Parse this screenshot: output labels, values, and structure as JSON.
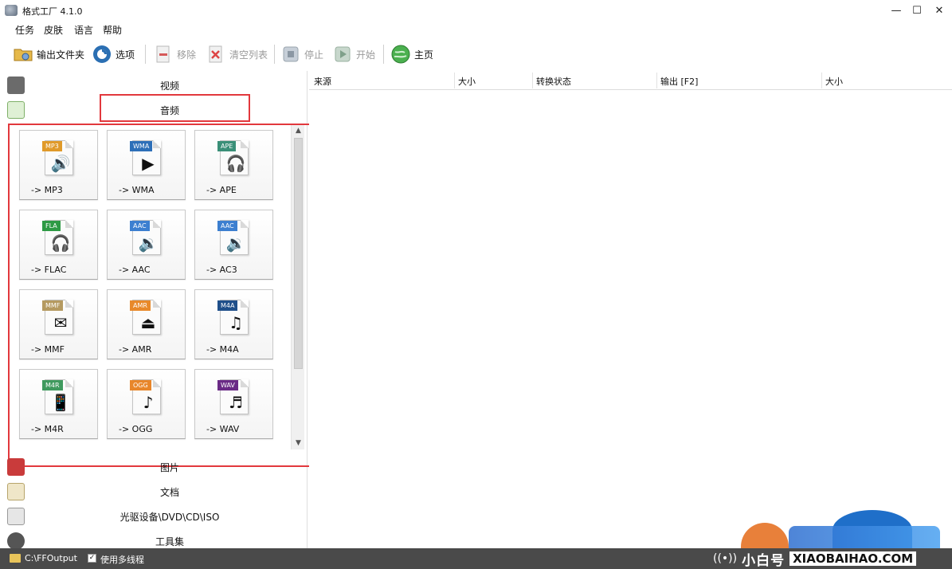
{
  "window": {
    "title": "格式工厂 4.1.0",
    "minimize": "—",
    "maximize": "☐",
    "close": "✕"
  },
  "menu": [
    "任务",
    "皮肤",
    "语言",
    "帮助"
  ],
  "toolbar": {
    "output_folder": "输出文件夹",
    "options": "选项",
    "remove": "移除",
    "clear_list": "清空列表",
    "stop": "停止",
    "start": "开始",
    "home": "主页"
  },
  "categories": {
    "video": "视频",
    "audio": "音频",
    "picture": "图片",
    "document": "文档",
    "optical": "光驱设备\\DVD\\CD\\ISO",
    "tools": "工具集"
  },
  "formats": [
    {
      "label": "-> MP3",
      "badge": "MP3",
      "badge_color": "#e09a2a",
      "glyph": "🔊"
    },
    {
      "label": "-> WMA",
      "badge": "WMA",
      "badge_color": "#2d6fb8",
      "glyph": "▶"
    },
    {
      "label": "-> APE",
      "badge": "APE",
      "badge_color": "#3a8f78",
      "glyph": "🎧"
    },
    {
      "label": "-> FLAC",
      "badge": "FLA",
      "badge_color": "#2e9a45",
      "glyph": "🎧"
    },
    {
      "label": "-> AAC",
      "badge": "AAC",
      "badge_color": "#3c7fd0",
      "glyph": "🔉"
    },
    {
      "label": "-> AC3",
      "badge": "AAC",
      "badge_color": "#3c7fd0",
      "glyph": "🔉"
    },
    {
      "label": "-> MMF",
      "badge": "MMF",
      "badge_color": "#b59a60",
      "glyph": "✉"
    },
    {
      "label": "-> AMR",
      "badge": "AMR",
      "badge_color": "#e8892a",
      "glyph": "⏏"
    },
    {
      "label": "-> M4A",
      "badge": "M4A",
      "badge_color": "#1f4f8a",
      "glyph": "♫"
    },
    {
      "label": "-> M4R",
      "badge": "M4R",
      "badge_color": "#3f9a5e",
      "glyph": "📱"
    },
    {
      "label": "-> OGG",
      "badge": "OGG",
      "badge_color": "#e8862a",
      "glyph": "♪"
    },
    {
      "label": "-> WAV",
      "badge": "WAV",
      "badge_color": "#6a2a86",
      "glyph": "♬"
    }
  ],
  "columns": [
    "来源",
    "大小",
    "转换状态",
    "输出 [F2]",
    "大小"
  ],
  "status": {
    "output_path": "C:\\FFOutput",
    "multithread_label": "使用多线程",
    "multithread_checked": "✓",
    "brand_cn": "小白号",
    "brand_en": "XIAOBAIHAO.COM"
  },
  "colors": {
    "highlight": "#e2383d",
    "statusbar": "#4a4a4a"
  }
}
